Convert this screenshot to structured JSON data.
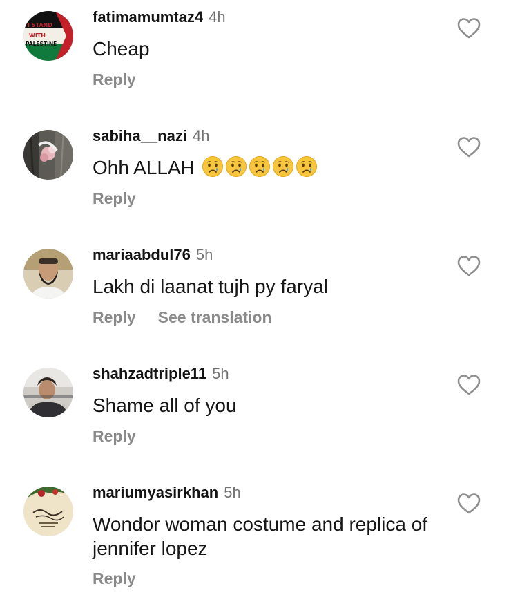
{
  "comments": [
    {
      "username": "fatimamumtaz4",
      "time": "4h",
      "text": "Cheap",
      "reply": "Reply",
      "avatar_icon": "palestine-flag-avatar",
      "avatar_text": [
        "I STAND",
        "WITH",
        "PALESTINE"
      ]
    },
    {
      "username": "sabiha__nazi",
      "time": "4h",
      "text": "Ohh ALLAH",
      "emoji": "crying-face-icon",
      "emoji_count": 5,
      "reply": "Reply",
      "avatar_icon": "flower-photo-avatar"
    },
    {
      "username": "mariaabdul76",
      "time": "5h",
      "text": "Lakh di laanat tujh py faryal",
      "reply": "Reply",
      "translate": "See translation",
      "avatar_icon": "bearded-man-avatar"
    },
    {
      "username": "shahzadtriple11",
      "time": "5h",
      "text": "Shame all of you",
      "reply": "Reply",
      "avatar_icon": "person-photo-avatar"
    },
    {
      "username": "mariumyasirkhan",
      "time": "5h",
      "text": "Wondor woman costume and replica of jennifer lopez",
      "reply": "Reply",
      "avatar_icon": "calligraphy-avatar"
    }
  ],
  "colors": {
    "text": "#161616",
    "secondary": "#737373",
    "action": "#8a8a8a",
    "heart": "#8e8e8e"
  }
}
